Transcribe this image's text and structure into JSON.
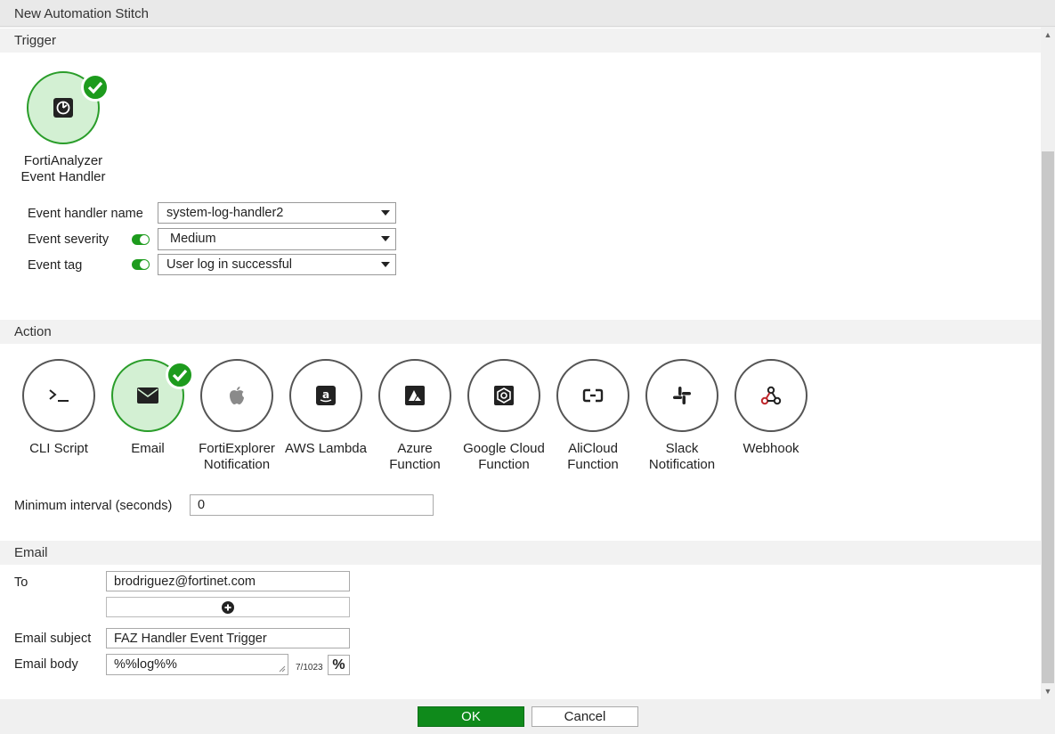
{
  "window": {
    "title": "New Automation Stitch"
  },
  "trigger": {
    "section_label": "Trigger",
    "selected": {
      "label_line1": "FortiAnalyzer",
      "label_line2": "Event Handler",
      "icon": "faz-event-handler-icon"
    },
    "fields": {
      "event_handler_name": {
        "label": "Event handler name",
        "value": "system-log-handler2"
      },
      "event_severity": {
        "label": "Event severity",
        "value": "Medium",
        "enabled": true
      },
      "event_tag": {
        "label": "Event tag",
        "value": "User log in successful",
        "enabled": true
      }
    }
  },
  "action": {
    "section_label": "Action",
    "items": [
      {
        "line1": "CLI Script",
        "line2": "",
        "icon": "terminal-icon",
        "selected": false
      },
      {
        "line1": "Email",
        "line2": "",
        "icon": "envelope-icon",
        "selected": true
      },
      {
        "line1": "FortiExplorer",
        "line2": "Notification",
        "icon": "apple-icon",
        "selected": false
      },
      {
        "line1": "AWS Lambda",
        "line2": "",
        "icon": "amazon-icon",
        "selected": false
      },
      {
        "line1": "Azure",
        "line2": "Function",
        "icon": "azure-icon",
        "selected": false
      },
      {
        "line1": "Google Cloud",
        "line2": "Function",
        "icon": "google-cloud-icon",
        "selected": false
      },
      {
        "line1": "AliCloud",
        "line2": "Function",
        "icon": "alicloud-icon",
        "selected": false
      },
      {
        "line1": "Slack",
        "line2": "Notification",
        "icon": "slack-icon",
        "selected": false
      },
      {
        "line1": "Webhook",
        "line2": "",
        "icon": "webhook-icon",
        "selected": false
      }
    ],
    "min_interval": {
      "label": "Minimum interval (seconds)",
      "value": "0"
    }
  },
  "email": {
    "section_label": "Email",
    "to_label": "To",
    "to_value": "brodriguez@fortinet.com",
    "subject_label": "Email subject",
    "subject_value": "FAZ Handler Event Trigger",
    "body_label": "Email body",
    "body_value": "%%log%%",
    "char_count": "7/1023",
    "macro_button": "%"
  },
  "footer": {
    "ok_label": "OK",
    "cancel_label": "Cancel"
  },
  "colors": {
    "accent_green": "#1d9b1d",
    "selected_fill": "#d3f0d3",
    "ok_button": "#0f8a1b"
  }
}
